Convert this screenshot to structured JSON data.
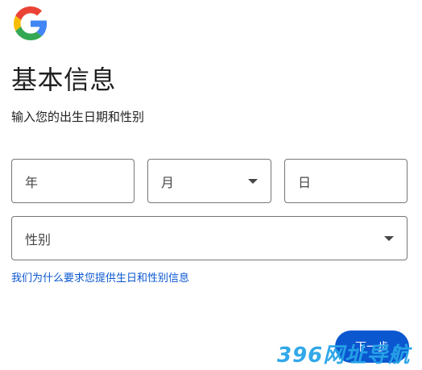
{
  "logo": {
    "name": "Google",
    "colors": {
      "blue": "#4285F4",
      "red": "#EA4335",
      "yellow": "#FBBC05",
      "green": "#34A853"
    }
  },
  "header": {
    "title": "基本信息",
    "subtitle": "输入您的出生日期和性别"
  },
  "fields": {
    "year": {
      "placeholder": "年"
    },
    "month": {
      "placeholder": "月"
    },
    "day": {
      "placeholder": "日"
    },
    "gender": {
      "placeholder": "性别"
    }
  },
  "help_link": "我们为什么要求您提供生日和性别信息",
  "next_button": "下一步",
  "watermark": "396网址导航",
  "colors": {
    "accent": "#0b57d0",
    "border": "#747775",
    "watermark": "#27a4e8"
  }
}
